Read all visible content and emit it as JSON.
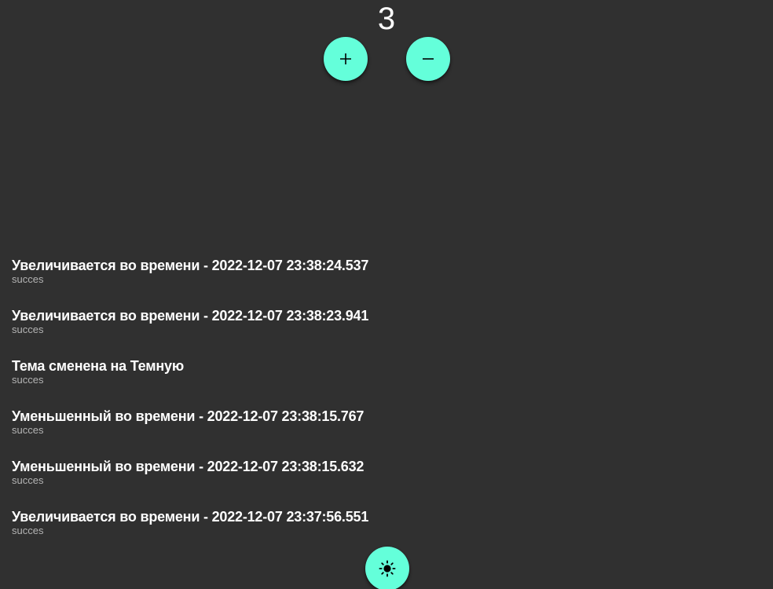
{
  "counter": {
    "value": "3"
  },
  "controls": {
    "increment_icon": "plus-icon",
    "decrement_icon": "minus-icon",
    "theme_icon": "sun-icon"
  },
  "log": {
    "items": [
      {
        "title": "Увеличивается во времени - 2022-12-07 23:38:24.537",
        "status": "succes"
      },
      {
        "title": "Увеличивается во времени - 2022-12-07 23:38:23.941",
        "status": "succes"
      },
      {
        "title": "Тема сменена на Темную",
        "status": "succes"
      },
      {
        "title": "Уменьшенный во времени - 2022-12-07 23:38:15.767",
        "status": "succes"
      },
      {
        "title": "Уменьшенный во времени - 2022-12-07 23:38:15.632",
        "status": "succes"
      },
      {
        "title": "Увеличивается во времени - 2022-12-07 23:37:56.551",
        "status": "succes"
      }
    ]
  },
  "colors": {
    "background": "#303030",
    "accent": "#64ffda",
    "text": "#ffffff",
    "subtext": "#b3b3b3"
  }
}
